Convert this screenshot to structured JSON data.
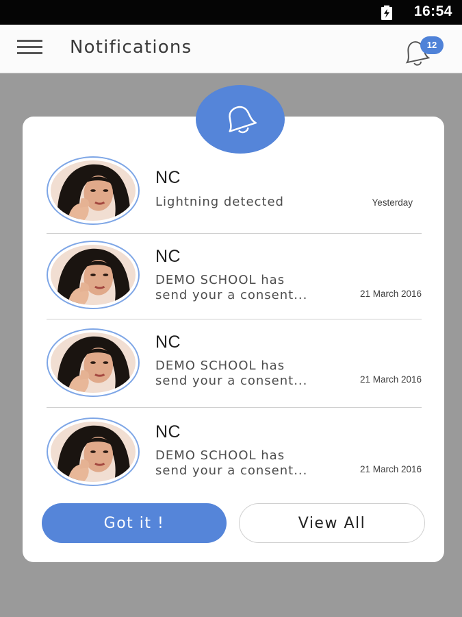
{
  "status_bar": {
    "time": "16:54",
    "battery_icon": "battery-charging-icon"
  },
  "app_bar": {
    "menu_icon": "hamburger-menu-icon",
    "title": "Notifications",
    "bell_icon": "bell-icon",
    "badge_count": "12"
  },
  "card": {
    "header_icon": "bell-icon"
  },
  "notifications": [
    {
      "sender": "NC",
      "message_lines": [
        "Lightning detected"
      ],
      "time": "Yesterday"
    },
    {
      "sender": "NC",
      "message_lines": [
        "DEMO SCHOOL has",
        "send your a consent..."
      ],
      "time": "21 March 2016"
    },
    {
      "sender": "NC",
      "message_lines": [
        "DEMO SCHOOL has",
        "send your a consent..."
      ],
      "time": "21 March 2016"
    },
    {
      "sender": "NC",
      "message_lines": [
        "DEMO SCHOOL has",
        "send your a consent..."
      ],
      "time": "21 March 2016"
    }
  ],
  "actions": {
    "primary_label": "Got it !",
    "secondary_label": "View All"
  },
  "colors": {
    "accent": "#5585d9",
    "badge": "#4f82d8",
    "background": "#9a9a9a",
    "status_bar": "#050505"
  }
}
